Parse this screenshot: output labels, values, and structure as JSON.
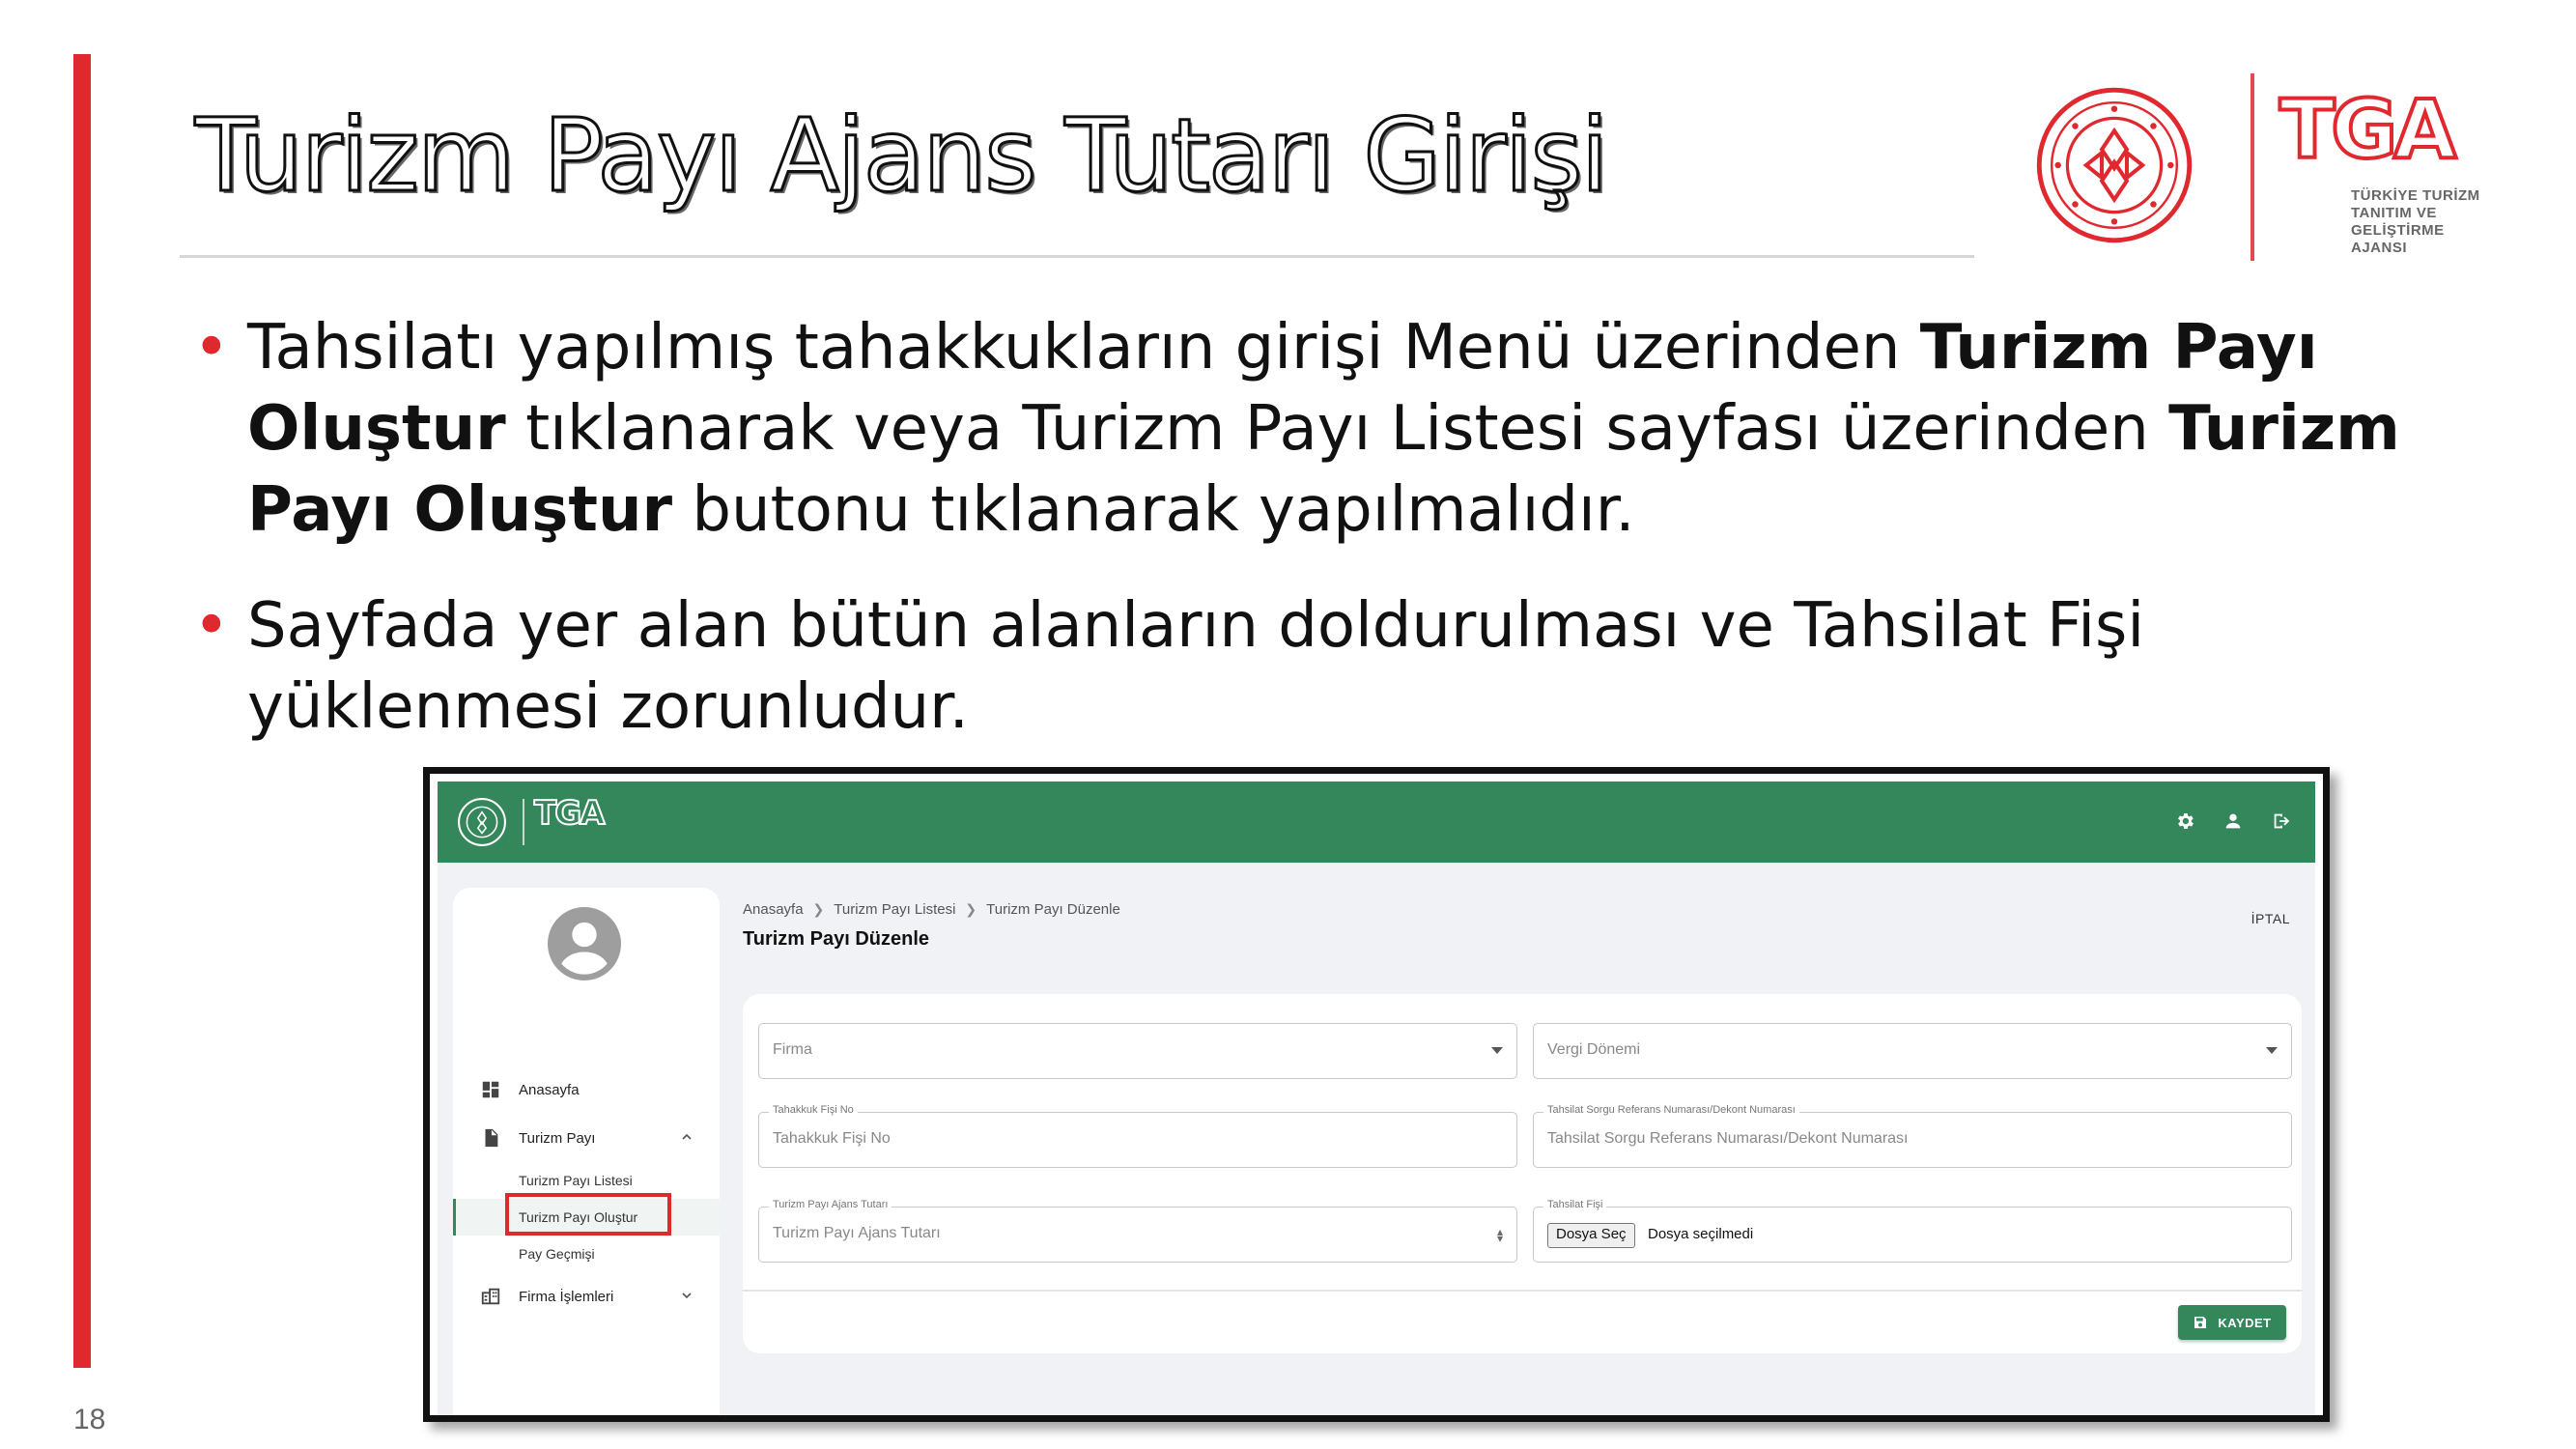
{
  "slide": {
    "title": "Turizm Payı Ajans Tutarı Girişi",
    "page_number": "18",
    "bullet1": {
      "t1": "Tahsilatı yapılmış tahakkukların girişi Menü üzerinden ",
      "b1": "Turizm Payı Oluştur",
      "t2": " tıklanarak veya Turizm Payı Listesi sayfası üzerinden ",
      "b2": "Turizm Payı Oluştur",
      "t3": " butonu tıklanarak yapılmalıdır."
    },
    "bullet2": "Sayfada yer alan bütün alanların doldurulması ve Tahsilat Fişi yüklenmesi zorunludur."
  },
  "logo": {
    "brand": "TGA",
    "line1": "TÜRKİYE TURİZM",
    "line2": "TANITIM VE GELİŞTİRME",
    "line3": "AJANSI"
  },
  "colors": {
    "accent_red": "#e0282f",
    "app_green": "#34865b"
  },
  "app": {
    "header": {
      "icons": [
        "gear-icon",
        "user-icon",
        "logout-icon"
      ]
    },
    "sidebar": {
      "items": [
        {
          "label": "Anasayfa",
          "icon": "dashboard-icon"
        },
        {
          "label": "Turizm Payı",
          "icon": "document-icon",
          "expanded": true
        },
        {
          "label": "Firma İşlemleri",
          "icon": "building-icon",
          "expanded": false
        }
      ],
      "subitems": [
        "Turizm Payı Listesi",
        "Turizm Payı Oluştur",
        "Pay Geçmişi"
      ],
      "active_subitem": "Turizm Payı Oluştur"
    },
    "breadcrumb": [
      "Anasayfa",
      "Turizm Payı Listesi",
      "Turizm Payı Düzenle"
    ],
    "page_title": "Turizm Payı Düzenle",
    "cancel_label": "İPTAL",
    "form": {
      "firma": {
        "placeholder": "Firma"
      },
      "vergi_donemi": {
        "placeholder": "Vergi Dönemi"
      },
      "tahakkuk_fisi_no": {
        "label": "Tahakkuk Fişi No",
        "placeholder": "Tahakkuk Fişi No"
      },
      "tahsilat_ref": {
        "label": "Tahsilat Sorgu Referans Numarası/Dekont Numarası",
        "placeholder": "Tahsilat Sorgu Referans Numarası/Dekont Numarası"
      },
      "ajans_tutari": {
        "label": "Turizm Payı Ajans Tutarı",
        "placeholder": "Turizm Payı Ajans Tutarı"
      },
      "tahsilat_fisi": {
        "label": "Tahsilat Fişi",
        "button": "Dosya Seç",
        "status": "Dosya seçilmedi"
      },
      "save_label": "KAYDET"
    }
  }
}
